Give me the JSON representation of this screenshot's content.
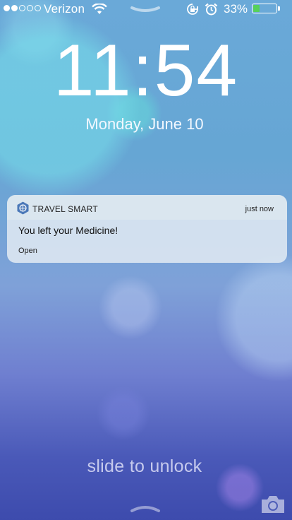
{
  "status_bar": {
    "signal_bars_filled": 2,
    "signal_bars_total": 5,
    "carrier": "Verizon",
    "battery_percent": "33%",
    "battery_level": 0.33,
    "battery_color": "#56d05a"
  },
  "lock_screen": {
    "time": "11:54",
    "date": "Monday, June 10",
    "slide_to_unlock": "slide to unlock"
  },
  "notification": {
    "app_name": "TRAVEL SMART",
    "timestamp": "just now",
    "message": "You left your Medicine!",
    "action": "Open"
  },
  "icons": [
    "wifi-icon",
    "rotation-lock-icon",
    "alarm-icon",
    "battery-icon",
    "camera-icon",
    "grabber-icon",
    "travel-smart-app-icon"
  ]
}
